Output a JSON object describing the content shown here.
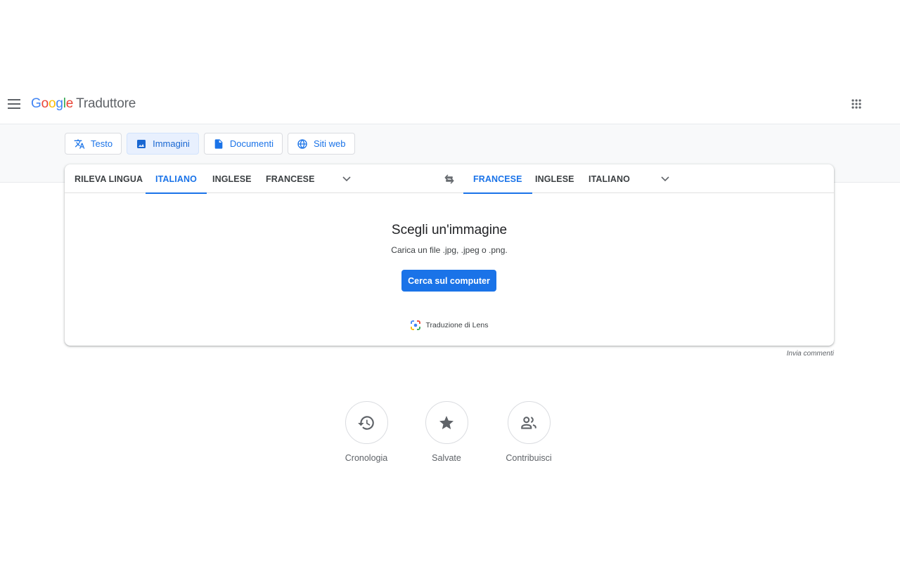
{
  "header": {
    "logo_letters": [
      "G",
      "o",
      "o",
      "g",
      "l",
      "e"
    ],
    "product": "Traduttore"
  },
  "modes": [
    {
      "label": "Testo",
      "icon": "translate-icon",
      "active": false
    },
    {
      "label": "Immagini",
      "icon": "image-icon",
      "active": true
    },
    {
      "label": "Documenti",
      "icon": "document-icon",
      "active": false
    },
    {
      "label": "Siti web",
      "icon": "globe-icon",
      "active": false
    }
  ],
  "source_langs": [
    {
      "label": "RILEVA LINGUA",
      "active": false
    },
    {
      "label": "ITALIANO",
      "active": true
    },
    {
      "label": "INGLESE",
      "active": false
    },
    {
      "label": "FRANCESE",
      "active": false
    }
  ],
  "target_langs": [
    {
      "label": "FRANCESE",
      "active": true
    },
    {
      "label": "INGLESE",
      "active": false
    },
    {
      "label": "ITALIANO",
      "active": false
    }
  ],
  "drop": {
    "title": "Scegli un'immagine",
    "subtitle": "Carica un file .jpg, .jpeg o .png.",
    "button": "Cerca sul computer",
    "lens": "Traduzione di Lens"
  },
  "feedback": "Invia commenti",
  "shortcuts": [
    {
      "label": "Cronologia",
      "icon": "history-icon"
    },
    {
      "label": "Salvate",
      "icon": "star-icon"
    },
    {
      "label": "Contribuisci",
      "icon": "people-icon"
    }
  ],
  "colors": {
    "accent": "#1a73e8",
    "band": "#f8f9fa",
    "google_blue": "#4285f4",
    "google_red": "#ea4335",
    "google_yellow": "#fbbc05",
    "google_green": "#34a853"
  }
}
